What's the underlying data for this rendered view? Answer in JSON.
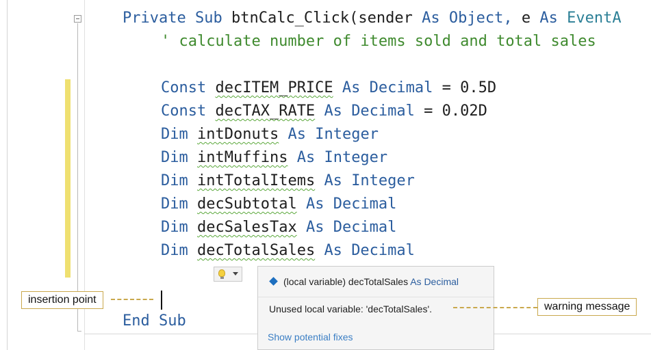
{
  "code": {
    "lines": {
      "sub_decl": {
        "kw_private": "Private",
        "kw_sub": "Sub",
        "name": "btnCalc_Click(sender",
        "kw_as1": "As",
        "type_object": "Object,",
        "param_e": "e",
        "kw_as2": "As",
        "type_event": "EventA"
      },
      "comment": "' calculate number of items sold and total sales",
      "const1": {
        "kw": "Const",
        "name": "decITEM_PRICE",
        "as": "As",
        "type": "Decimal",
        "rest": "= 0.5D"
      },
      "const2": {
        "kw": "Const",
        "name": "decTAX_RATE",
        "as": "As",
        "type": "Decimal",
        "rest": "= 0.02D"
      },
      "dim1": {
        "kw": "Dim",
        "name": "intDonuts",
        "as": "As",
        "type": "Integer"
      },
      "dim2": {
        "kw": "Dim",
        "name": "intMuffins",
        "as": "As",
        "type": "Integer"
      },
      "dim3": {
        "kw": "Dim",
        "name": "intTotalItems",
        "as": "As",
        "type": "Integer"
      },
      "dim4": {
        "kw": "Dim",
        "name": "decSubtotal",
        "as": "As",
        "type": "Decimal"
      },
      "dim5": {
        "kw": "Dim",
        "name": "decSalesTax",
        "as": "As",
        "type": "Decimal"
      },
      "dim6": {
        "kw": "Dim",
        "name": "decTotalSales",
        "as": "As",
        "type": "Decimal"
      },
      "end_sub": "End Sub"
    }
  },
  "tooltip": {
    "symbol_prefix": "(local variable) decTotalSales",
    "symbol_type": "As Decimal",
    "warning": "Unused local variable: 'decTotalSales'.",
    "fix_link": "Show potential fixes"
  },
  "callouts": {
    "insertion_point": "insertion point",
    "warning_message": "warning message"
  },
  "icons": {
    "lightbulb": "lightbulb-icon",
    "dropdown": "chevron-down-icon",
    "local_variable": "local-variable-icon"
  },
  "colors": {
    "keyword": "#2b5d9e",
    "comment": "#3f8a2e",
    "change_bar": "#efe070",
    "callout_border": "#c9a84c",
    "link": "#3a7ec4"
  }
}
